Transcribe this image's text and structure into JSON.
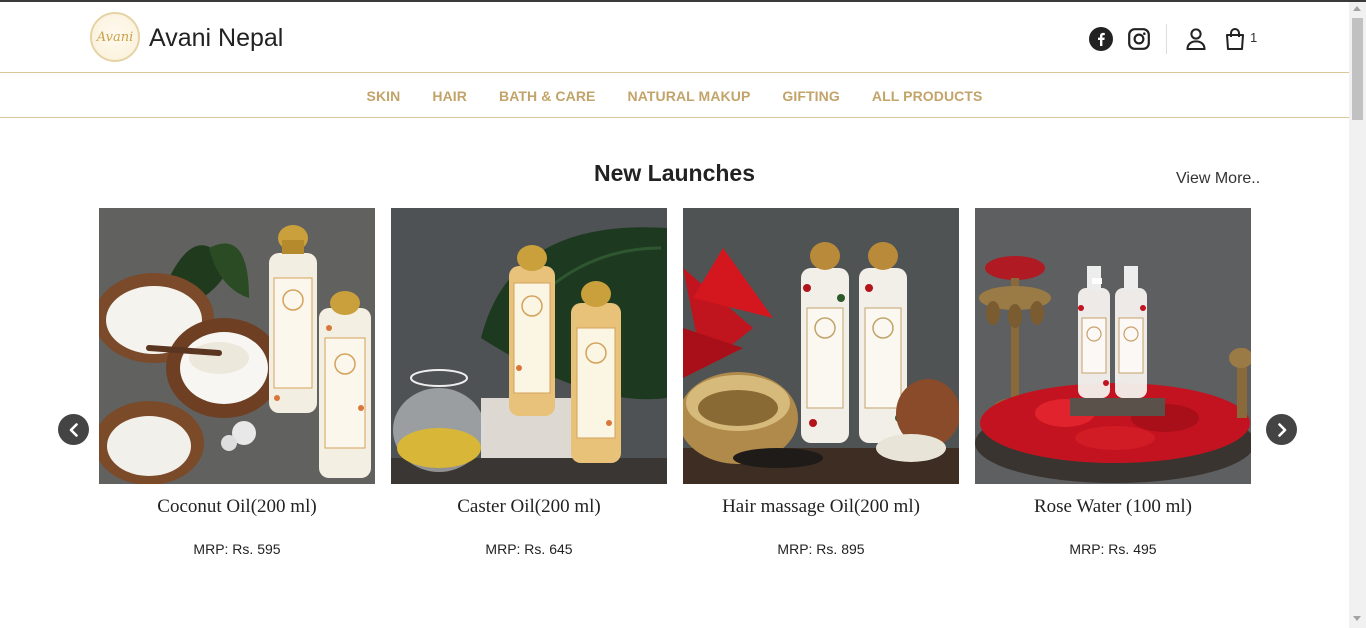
{
  "header": {
    "brand": "Avani Nepal",
    "logo_text": "Avani",
    "cart_count": "1",
    "icons": [
      "facebook-icon",
      "instagram-icon",
      "user-icon",
      "shopping-bag-icon"
    ]
  },
  "nav": {
    "items": [
      {
        "label": "SKIN"
      },
      {
        "label": "HAIR"
      },
      {
        "label": "BATH & CARE"
      },
      {
        "label": "NATURAL MAKUP"
      },
      {
        "label": "GIFTING"
      },
      {
        "label": "ALL PRODUCTS"
      }
    ]
  },
  "section": {
    "title": "New Launches",
    "view_more": "View More.."
  },
  "products": [
    {
      "name": "Coconut Oil(200 ml)",
      "price": "MRP: Rs. 595"
    },
    {
      "name": "Caster Oil(200 ml)",
      "price": "MRP: Rs. 645"
    },
    {
      "name": "Hair massage Oil(200 ml)",
      "price": "MRP: Rs. 895"
    },
    {
      "name": "Rose Water (100 ml)",
      "price": "MRP: Rs. 495"
    }
  ],
  "colors": {
    "accent_gold": "#c2a46a",
    "divider": "#d9c89a",
    "arrow": "#444444"
  }
}
